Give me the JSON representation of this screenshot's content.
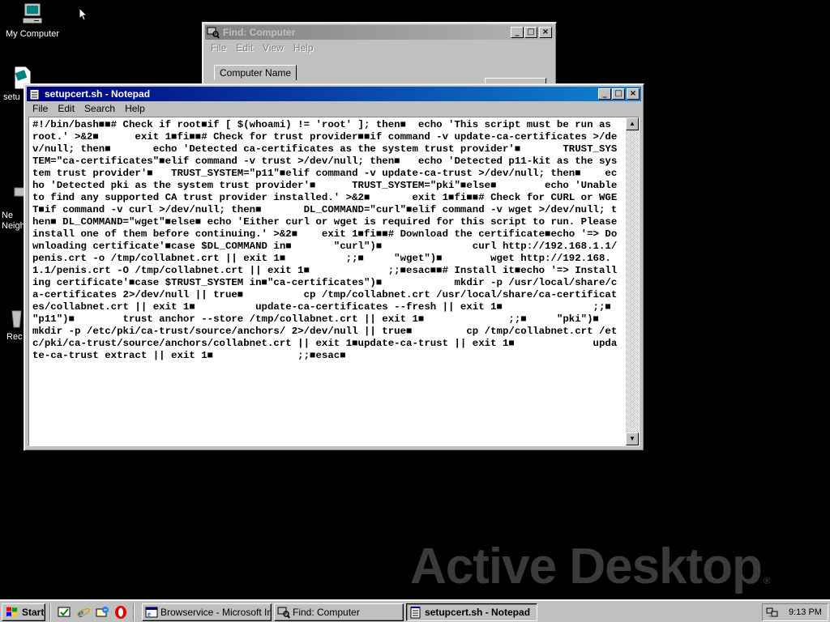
{
  "desktop": {
    "icons": [
      {
        "label": "My Computer",
        "icon": "my-computer-icon"
      },
      {
        "label": "setu",
        "icon": "shell-script-file-icon"
      },
      {
        "label": "Ne\nNeigh",
        "icon": "network-neighborhood-icon"
      },
      {
        "label": "Rec",
        "icon": "recycle-bin-icon"
      }
    ],
    "watermark": "Active Desktop",
    "watermark_mark": "®"
  },
  "find_window": {
    "title": "Find: Computer",
    "menu": [
      "File",
      "Edit",
      "View",
      "Help"
    ],
    "tab_label": "Computer Name"
  },
  "notepad": {
    "title": "setupcert.sh - Notepad",
    "menu": [
      "File",
      "Edit",
      "Search",
      "Help"
    ],
    "content": "#!/bin/bash■■# Check if root■if [ $(whoami) != 'root' ]; then■  echo 'This script must be run as root.' >&2■      exit 1■fi■■# Check for trust provider■■if command -v update-ca-certificates >/dev/null; then■       echo 'Detected ca-certificates as the system trust provider'■       TRUST_SYSTEM=\"ca-certificates\"■elif command -v trust >/dev/null; then■   echo 'Detected p11-kit as the system trust provider'■   TRUST_SYSTEM=\"p11\"■elif command -v update-ca-trust >/dev/null; then■    echo 'Detected pki as the system trust provider'■      TRUST_SYSTEM=\"pki\"■else■        echo 'Unable to find any supported CA trust provider installed.' >&2■       exit 1■fi■■# Check for CURL or WGET■if command -v curl >/dev/null; then■       DL_COMMAND=\"curl\"■elif command -v wget >/dev/null; then■ DL_COMMAND=\"wget\"■else■ echo 'Either curl or wget is required for this script to run. Please install one of them before continuing.' >&2■    exit 1■fi■■# Download the certificate■echo '=> Downloading certificate'■case $DL_COMMAND in■       \"curl\")■               curl http://192.168.1.1/penis.crt -o /tmp/collabnet.crt || exit 1■          ;;■     \"wget\")■        wget http://192.168.1.1/penis.crt -O /tmp/collabnet.crt || exit 1■             ;;■esac■■# Install it■echo '=> Installing certificate'■case $TRUST_SYSTEM in■\"ca-certificates\")■            mkdir -p /usr/local/share/ca-certificates 2>/dev/null || true■          cp /tmp/collabnet.crt /usr/local/share/ca-certificates/collabnet.crt || exit 1■          update-ca-certificates --fresh || exit 1■               ;;■     \"p11\")■        trust anchor --store /tmp/collabnet.crt || exit 1■              ;;■     \"pki\")■        mkdir -p /etc/pki/ca-trust/source/anchors/ 2>/dev/null || true■         cp /tmp/collabnet.crt /etc/pki/ca-trust/source/anchors/collabnet.crt || exit 1■update-ca-trust || exit 1■             update-ca-trust extract || exit 1■              ;;■esac■"
  },
  "taskbar": {
    "start_label": "Start",
    "quick_launch": [
      "show-desktop-icon",
      "internet-explorer-icon",
      "outlook-express-icon",
      "opera-icon"
    ],
    "tasks": [
      {
        "label": "Browservice - Microsoft Int...",
        "icon": "internet-explorer-icon",
        "active": false
      },
      {
        "label": "Find: Computer",
        "icon": "find-computer-icon",
        "active": false
      },
      {
        "label": "setupcert.sh - Notepad",
        "icon": "notepad-icon",
        "active": true
      }
    ],
    "clock": "9:13 PM"
  }
}
